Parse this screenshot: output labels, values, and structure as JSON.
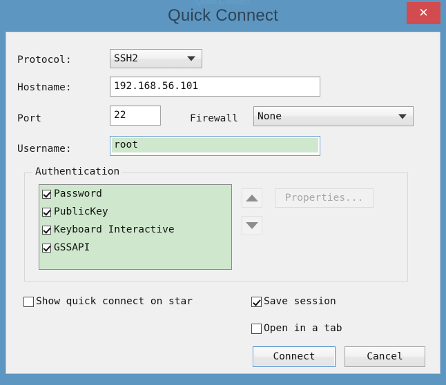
{
  "window": {
    "title": "Quick Connect",
    "ghost_title": "Quick Connect",
    "close_label": "✕",
    "accent_color": "#5d96c0",
    "close_color": "#d24b4e",
    "highlight_color": "#cfe8cd",
    "focus_border_color": "#6a9fd0"
  },
  "form": {
    "protocol": {
      "label": "Protocol:",
      "value": "SSH2",
      "caret": "chevron-down-icon"
    },
    "hostname": {
      "label": "Hostname:",
      "value": "192.168.56.101",
      "placeholder": ""
    },
    "port": {
      "label": "Port",
      "value": "22",
      "placeholder": ""
    },
    "firewall": {
      "label": "Firewall",
      "value": "None",
      "caret": "chevron-down-icon"
    },
    "username": {
      "label": "Username:",
      "value": "root",
      "placeholder": ""
    }
  },
  "authentication": {
    "legend": "Authentication",
    "methods": [
      {
        "label": "Password",
        "checked": true
      },
      {
        "label": "PublicKey",
        "checked": true
      },
      {
        "label": "Keyboard Interactive",
        "checked": true
      },
      {
        "label": "GSSAPI",
        "checked": true
      }
    ],
    "move_up_label": "triangle-up-icon",
    "move_down_label": "triangle-down-icon",
    "properties_label": "Properties...",
    "properties_enabled": false
  },
  "options": {
    "show_quick_connect": {
      "label": "Show quick connect on star",
      "checked": false
    },
    "save_session": {
      "label": "Save session",
      "checked": true
    },
    "open_in_tab": {
      "label": "Open in a tab",
      "checked": false
    }
  },
  "buttons": {
    "connect": "Connect",
    "cancel": "Cancel"
  }
}
